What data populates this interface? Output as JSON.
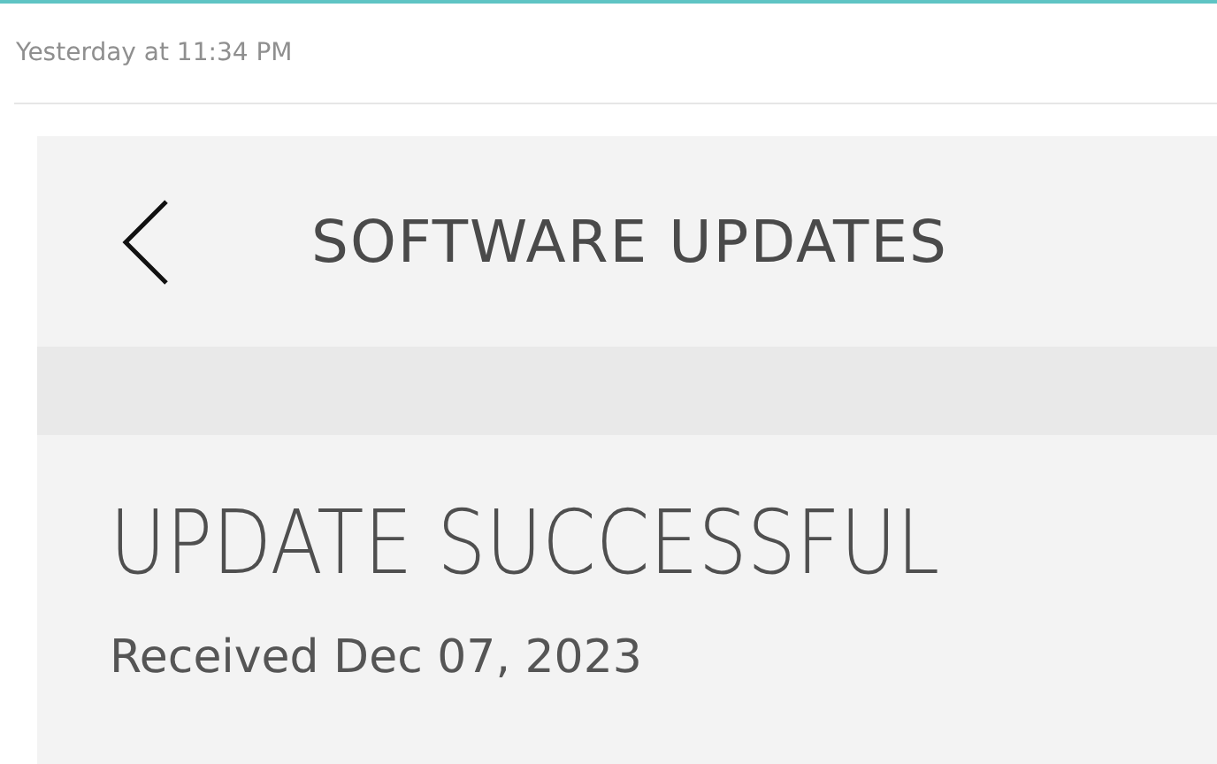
{
  "post": {
    "timestamp": "Yesterday at 11:34 PM"
  },
  "screenshot": {
    "header": {
      "title": "SOFTWARE UPDATES"
    },
    "status": {
      "heading": "UPDATE SUCCESSFUL",
      "received": "Received Dec 07, 2023"
    }
  }
}
